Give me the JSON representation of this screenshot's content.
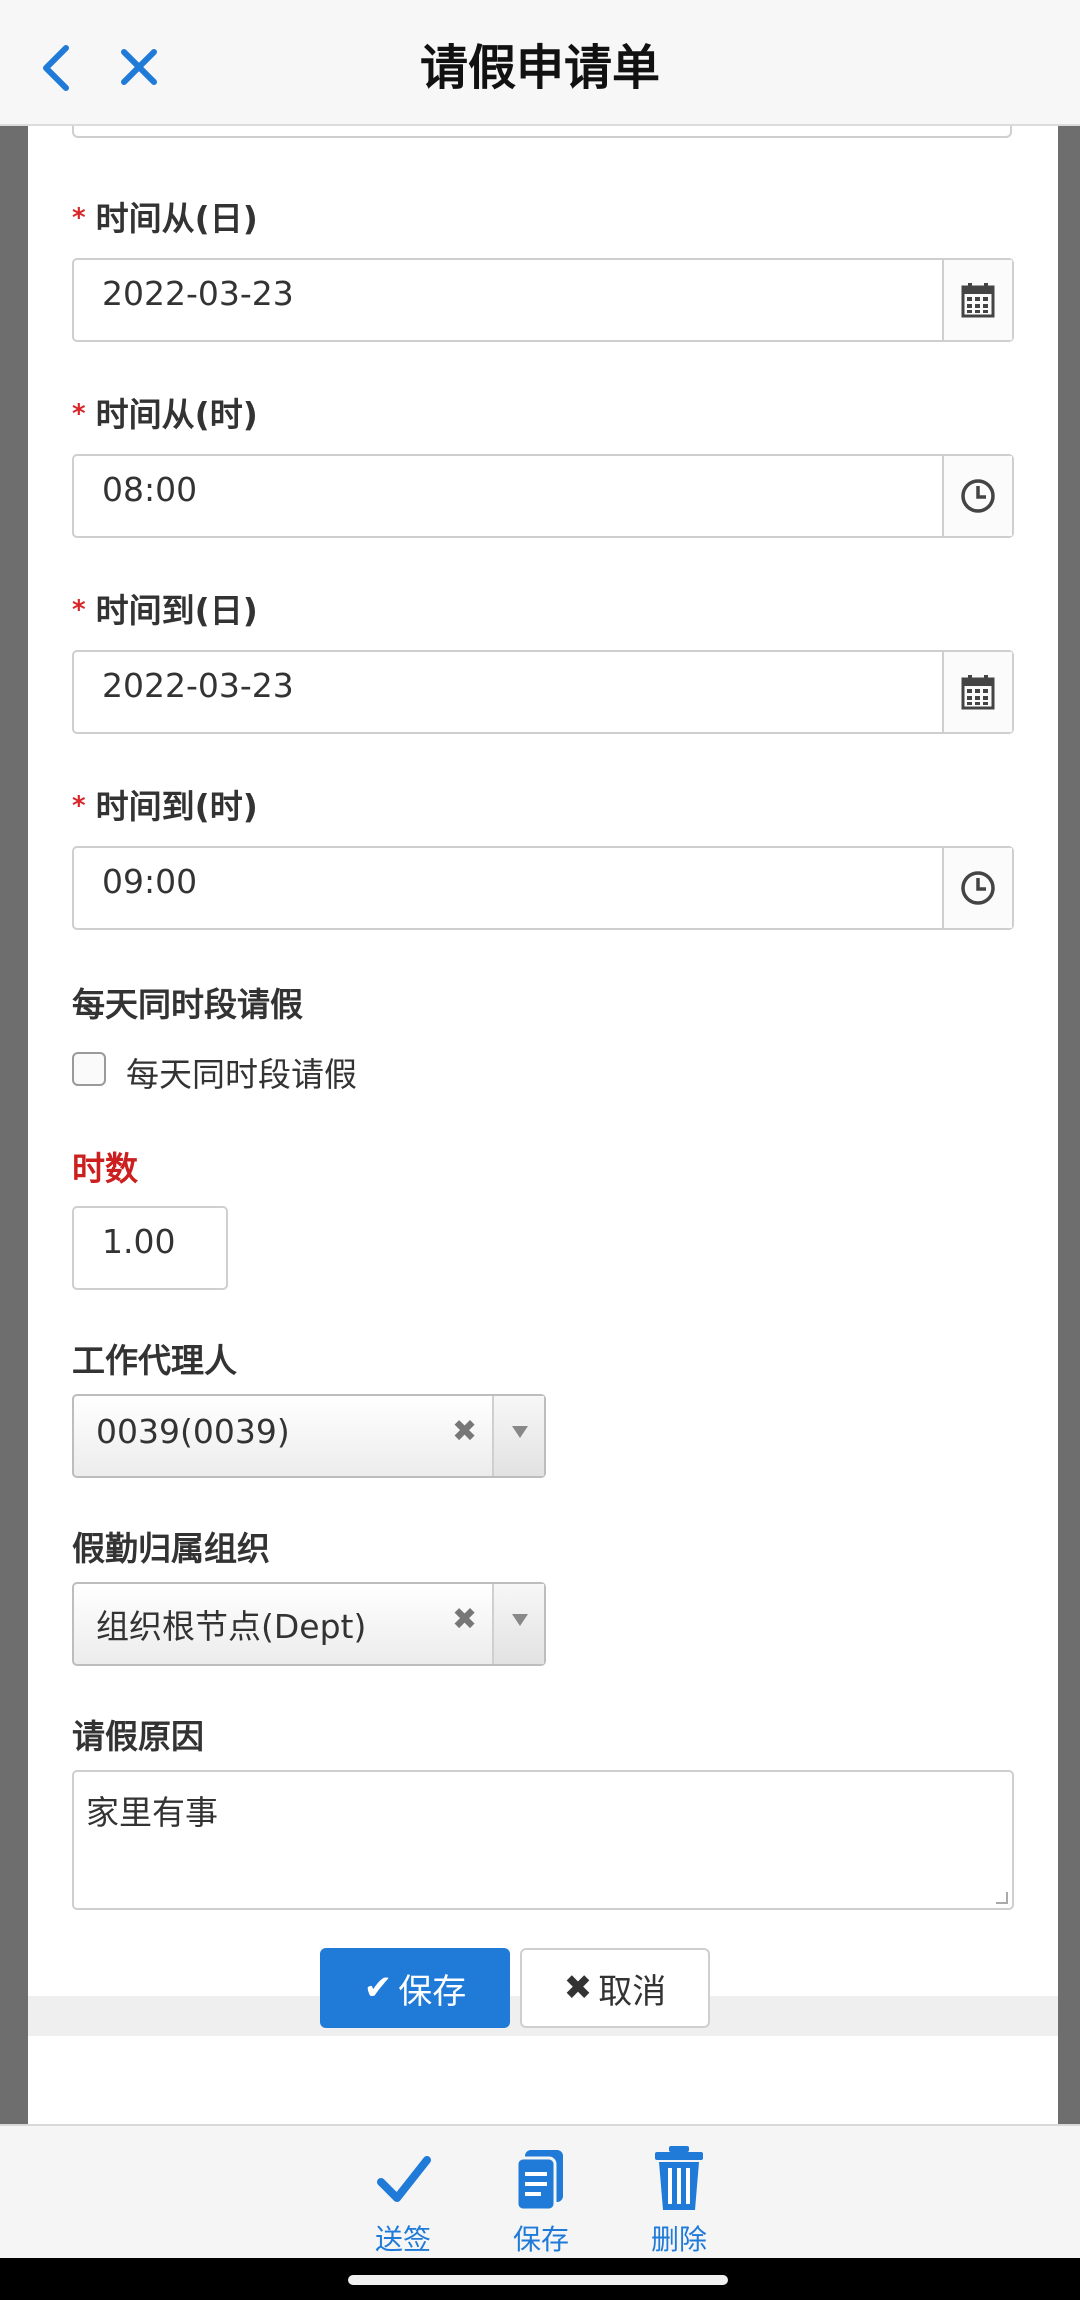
{
  "header": {
    "title": "请假申请单",
    "back_icon": "chevron-left-icon",
    "close_icon": "close-icon",
    "accent_color": "#1f7ad8"
  },
  "form": {
    "date_from": {
      "label": "时间从(日)",
      "required": true,
      "value": "2022-03-23",
      "icon": "calendar-icon"
    },
    "time_from": {
      "label": "时间从(时)",
      "required": true,
      "value": "08:00",
      "icon": "clock-icon"
    },
    "date_to": {
      "label": "时间到(日)",
      "required": true,
      "value": "2022-03-23",
      "icon": "calendar-icon"
    },
    "time_to": {
      "label": "时间到(时)",
      "required": true,
      "value": "09:00",
      "icon": "clock-icon"
    },
    "same_period": {
      "label": "每天同时段请假",
      "checkbox_text": "每天同时段请假",
      "checked": false
    },
    "hours": {
      "label": "时数",
      "value": "1.00",
      "label_color": "#cc1f1f"
    },
    "agent": {
      "label": "工作代理人",
      "value": "0039(0039)",
      "clear": "✖"
    },
    "org": {
      "label": "假勤归属组织",
      "value": "组织根节点(Dept)",
      "clear": "✖"
    },
    "reason": {
      "label": "请假原因",
      "value": "家里有事"
    },
    "required_mark": "*"
  },
  "buttons": {
    "save": {
      "label": "保存",
      "icon": "✔"
    },
    "cancel": {
      "label": "取消",
      "icon": "✖"
    }
  },
  "toolbar": {
    "submit": {
      "label": "送签",
      "icon": "checkmark-icon"
    },
    "save": {
      "label": "保存",
      "icon": "document-icon"
    },
    "delete": {
      "label": "删除",
      "icon": "trash-icon"
    }
  }
}
